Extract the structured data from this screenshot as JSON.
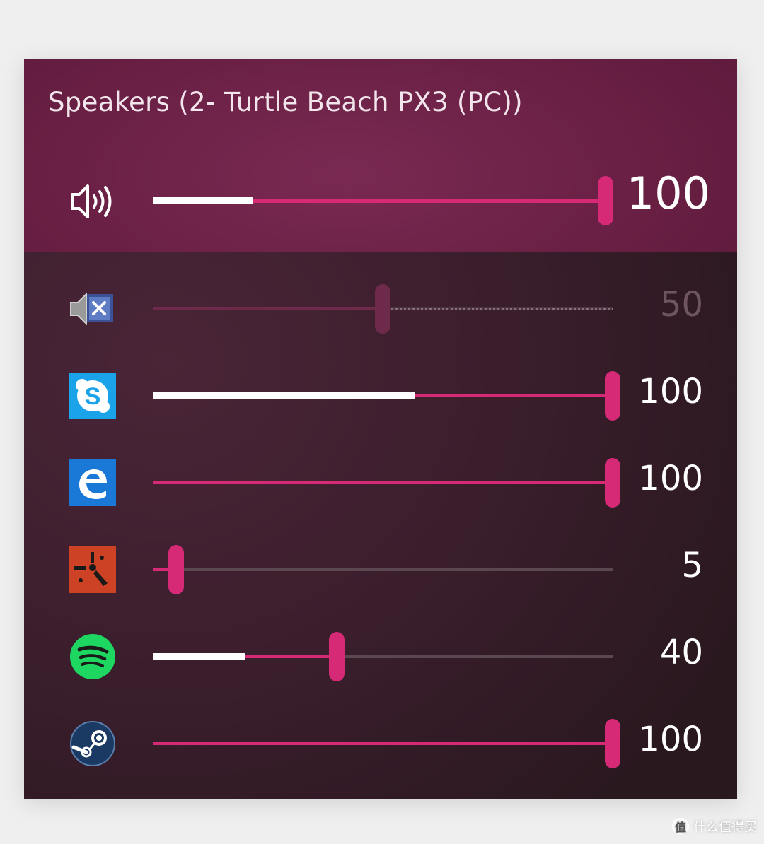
{
  "device": {
    "title": "Speakers (2- Turtle Beach PX3 (PC))"
  },
  "master": {
    "icon": "speaker-volume-icon",
    "value": "100",
    "level": 100,
    "peak": 22,
    "muted": false
  },
  "apps": [
    {
      "name_icon": "system-sounds-muted-icon",
      "value": "50",
      "level": 50,
      "peak": 0,
      "muted": true
    },
    {
      "name_icon": "skype-icon",
      "value": "100",
      "level": 100,
      "peak": 57,
      "muted": false
    },
    {
      "name_icon": "edge-icon",
      "value": "100",
      "level": 100,
      "peak": 0,
      "muted": false
    },
    {
      "name_icon": "rust-game-icon",
      "value": "5",
      "level": 5,
      "peak": 0,
      "muted": false
    },
    {
      "name_icon": "spotify-icon",
      "value": "40",
      "level": 40,
      "peak": 20,
      "muted": false
    },
    {
      "name_icon": "steam-icon",
      "value": "100",
      "level": 100,
      "peak": 0,
      "muted": false
    }
  ],
  "colors": {
    "accent": "#d62976",
    "header": "#6a2044",
    "panel": "#3d1f2e",
    "peak": "#ffffff"
  },
  "watermark": {
    "logo": "值",
    "text": "什么值得买"
  }
}
